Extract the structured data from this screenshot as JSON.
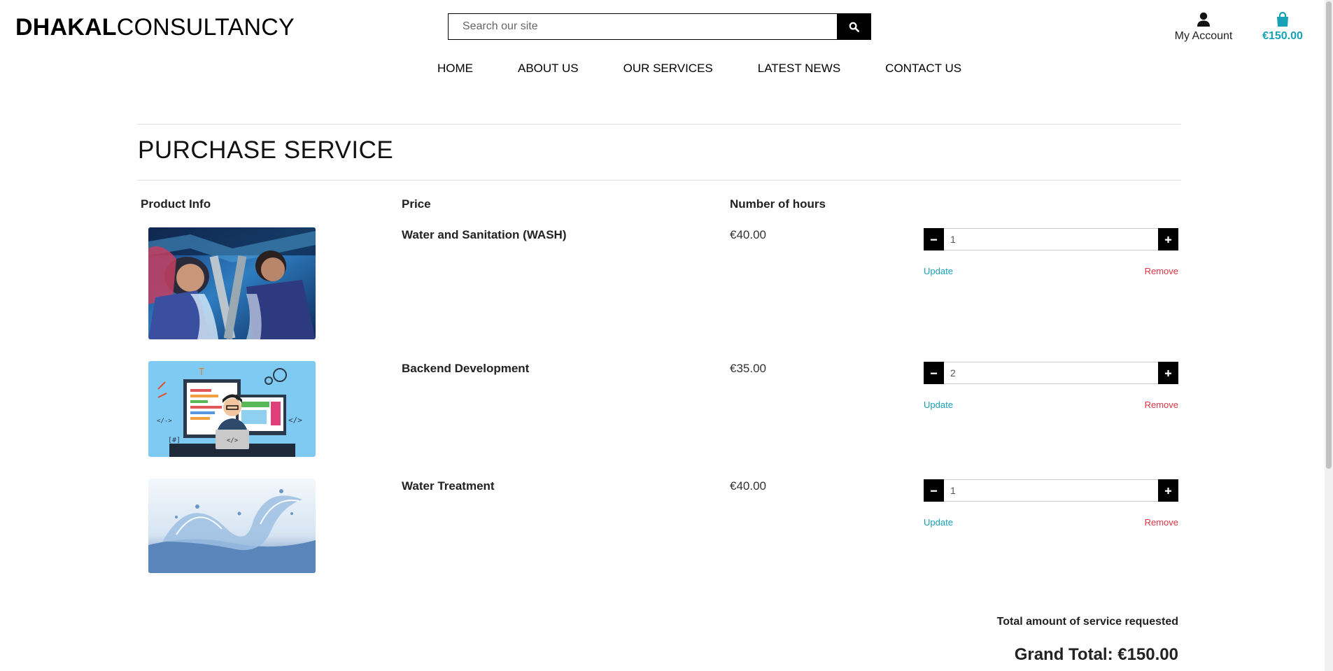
{
  "header": {
    "logo_bold": "DHAKAL",
    "logo_light": "CONSULTANCY",
    "search_placeholder": "Search our site",
    "account_label": "My Account",
    "bag_total": "€150.00"
  },
  "nav": {
    "items": [
      "HOME",
      "ABOUT US",
      "OUR SERVICES",
      "LATEST NEWS",
      "CONTACT US"
    ]
  },
  "page": {
    "title": "PURCHASE SERVICE",
    "col_product": "Product Info",
    "col_price": "Price",
    "col_hours": "Number of hours",
    "update_label": "Update",
    "remove_label": "Remove"
  },
  "items": [
    {
      "name": "Water and Sanitation (WASH)",
      "price": "€40.00",
      "qty": "1",
      "image": "children-drinking-water-photo"
    },
    {
      "name": "Backend Development",
      "price": "€35.00",
      "qty": "2",
      "image": "developer-illustration"
    },
    {
      "name": "Water Treatment",
      "price": "€40.00",
      "qty": "1",
      "image": "water-splash-photo"
    }
  ],
  "totals": {
    "label": "Total amount of service requested",
    "grand_total": "Grand Total: €150.00"
  },
  "colors": {
    "accent": "#17a2b8",
    "danger": "#dc3545",
    "dark": "#000000"
  }
}
